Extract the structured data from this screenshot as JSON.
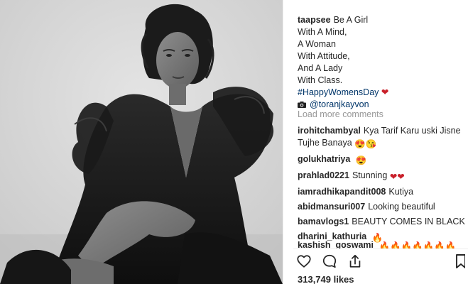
{
  "post": {
    "username": "taapsee",
    "caption_lines": [
      "Be A Girl",
      "With A Mind,",
      "A Woman",
      "With Attitude,",
      "And A Lady",
      "With Class."
    ],
    "hashtag": "#HappyWomensDay",
    "hashtag_emoji": "❤",
    "photo_credit_emoji": "📷",
    "photo_credit": "@toranjkayvon",
    "load_more": "Load more comments",
    "likes": "313,749 likes"
  },
  "comments": [
    {
      "user": "irohitchambyal",
      "text": "Kya Tarif Karu uski Jisne Tujhe Banaya",
      "emoji": "😍😘"
    },
    {
      "user": "golukhatriya",
      "text": "",
      "emoji": "😍"
    },
    {
      "user": "prahlad0221",
      "text": "Stunning",
      "emoji": "❤❤"
    },
    {
      "user": "iamradhikapandit008",
      "text": "Kutiya",
      "emoji": ""
    },
    {
      "user": "abidmansuri007",
      "text": "Looking beautiful",
      "emoji": ""
    },
    {
      "user": "bamavlogs1",
      "text": "BEAUTY COMES IN BLACK",
      "emoji": ""
    },
    {
      "user": "dharini_kathuria",
      "text": "",
      "emoji": "🔥"
    }
  ],
  "partial_comment": {
    "user": "kashish_goswami",
    "emoji": "🔥🔥🔥🔥🔥🔥🔥"
  },
  "icons": [
    "heart-outline-icon",
    "comment-bubble-icon",
    "share-icon",
    "bookmark-icon",
    "camera-icon"
  ],
  "colors": {
    "link": "#003569",
    "text": "#262626",
    "muted": "#999999",
    "heart": "#c9202a",
    "fire": "#f26a1b"
  }
}
